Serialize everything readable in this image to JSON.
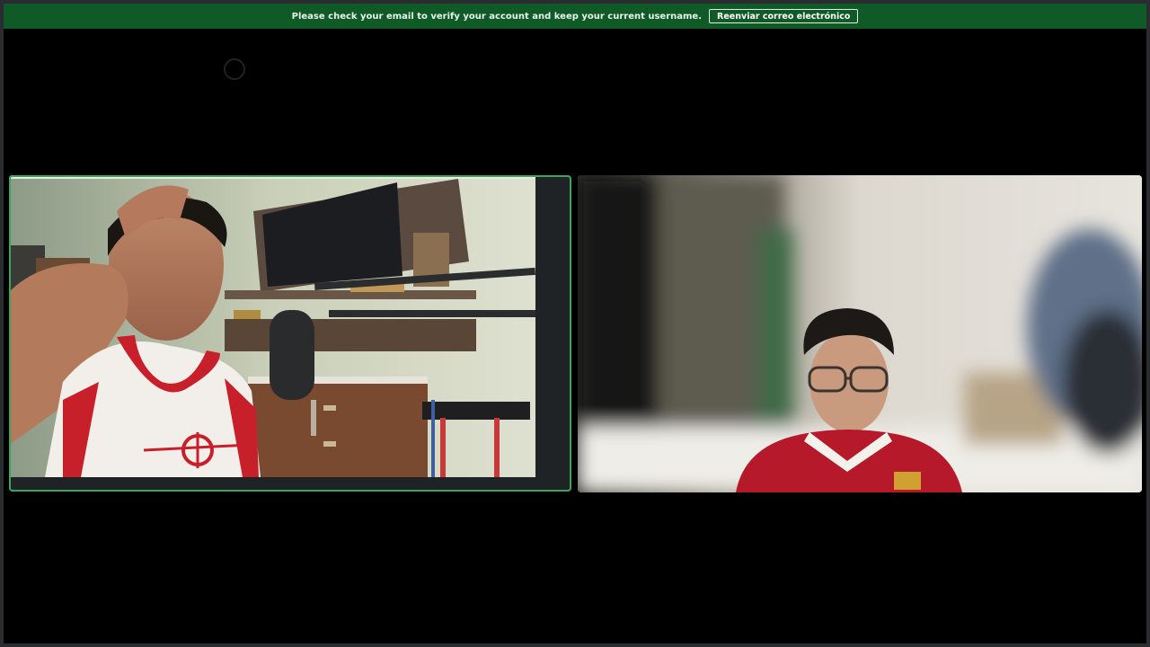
{
  "notice": {
    "message": "Please check your email to verify your account and keep your current username.",
    "button_label": "Reenviar correo electrónico"
  },
  "colors": {
    "notice_background": "#0f5a26",
    "speaking_border": "#3ba55d",
    "stage_background": "#000000"
  },
  "participants": [
    {
      "tile": "left",
      "speaking": true,
      "media": "camera-feed"
    },
    {
      "tile": "right",
      "speaking": false,
      "media": "camera-feed"
    }
  ]
}
